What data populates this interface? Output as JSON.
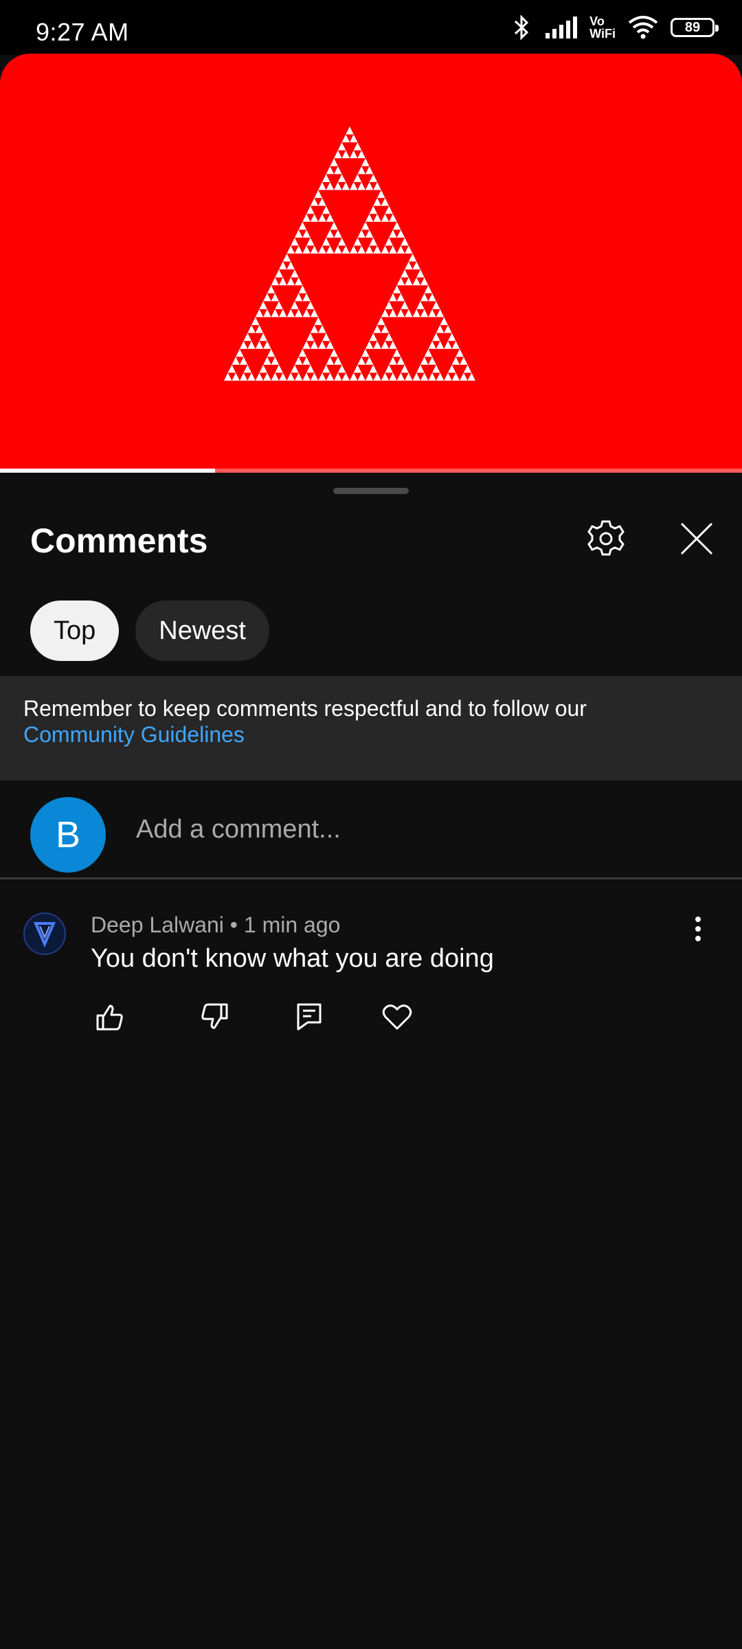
{
  "status_bar": {
    "time": "9:27 AM",
    "battery": "89",
    "vowifi_top": "Vo",
    "vowifi_bottom": "WiFi",
    "icons": [
      "bluetooth-icon",
      "signal-icon",
      "vowifi-icon",
      "wifi-icon",
      "battery-icon"
    ]
  },
  "video": {
    "background_color": "#ff0000",
    "thumbnail": "sierpinski-triangle",
    "progress_fraction": 0.29
  },
  "comments_sheet": {
    "title": "Comments",
    "settings_icon": "gear-icon",
    "close_icon": "close-icon",
    "sort_chips": [
      {
        "label": "Top",
        "selected": true
      },
      {
        "label": "Newest",
        "selected": false
      }
    ],
    "notice": {
      "text": "Remember to keep comments respectful and to follow our",
      "link": "Community Guidelines"
    },
    "add_comment": {
      "avatar_letter": "B",
      "avatar_color": "#0a87d6",
      "placeholder": "Add a comment..."
    },
    "comments": [
      {
        "author": "Deep Lalwani",
        "time": "1 min ago",
        "meta": "Deep Lalwani • 1 min ago",
        "text": "You don't know what you are doing",
        "actions": [
          "like-icon",
          "dislike-icon",
          "reply-icon",
          "heart-icon"
        ]
      }
    ]
  },
  "colors": {
    "background": "#0f0f0f",
    "notice_bg": "#272727",
    "link": "#3ea6ff",
    "chip_active_bg": "#f1f1f1",
    "chip_inactive_bg": "#272727"
  }
}
